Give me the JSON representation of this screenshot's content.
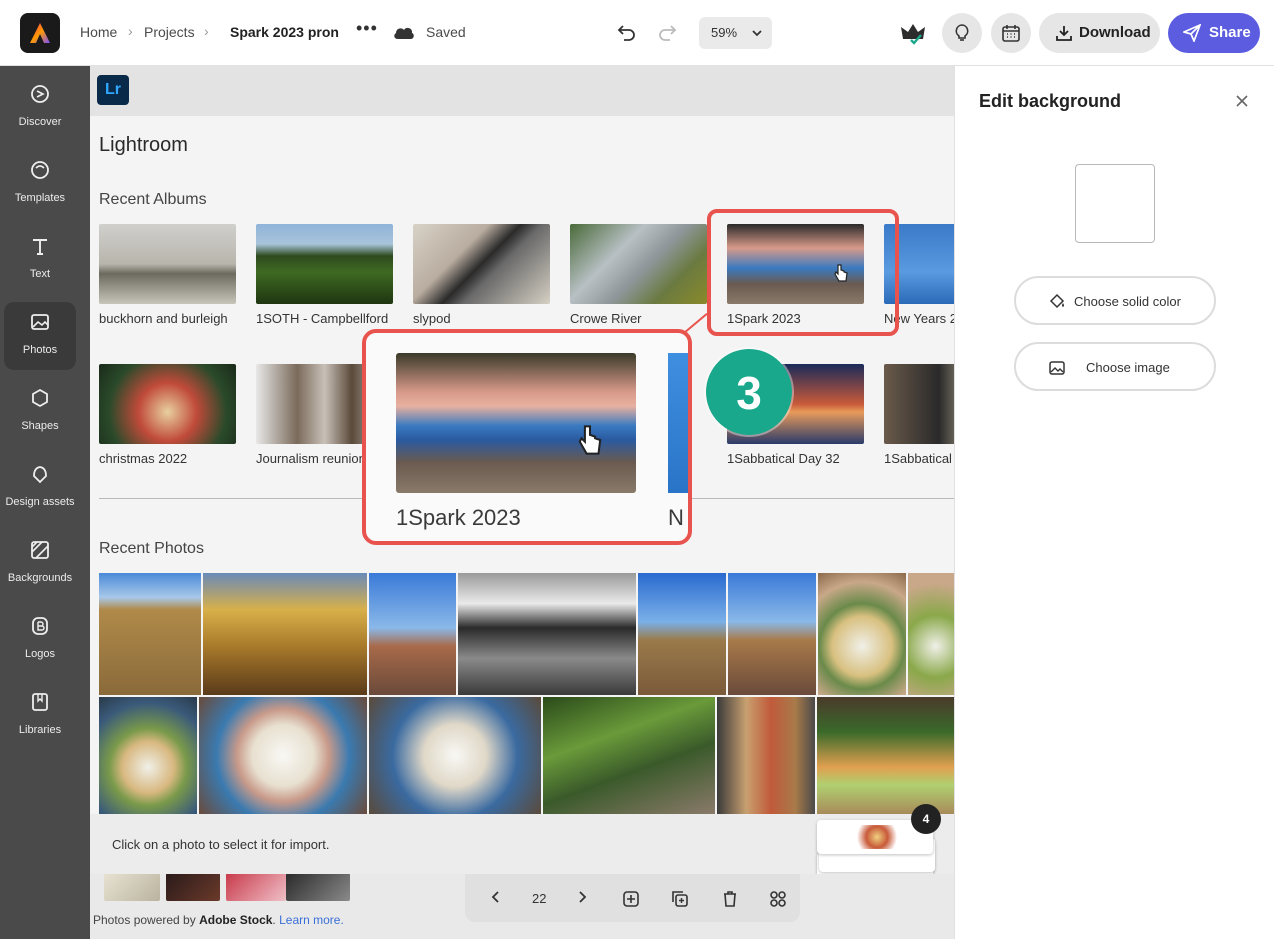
{
  "header": {
    "breadcrumbs": [
      "Home",
      "Projects"
    ],
    "doc_title": "Spark 2023 pron",
    "save_status": "Saved",
    "zoom": "59%",
    "download_label": "Download",
    "share_label": "Share",
    "accent": "#5c5ce0"
  },
  "rail": {
    "items": [
      {
        "label": "Discover",
        "icon": "discover-icon"
      },
      {
        "label": "Templates",
        "icon": "templates-icon"
      },
      {
        "label": "Text",
        "icon": "text-icon"
      },
      {
        "label": "Photos",
        "icon": "photos-icon",
        "active": true
      },
      {
        "label": "Shapes",
        "icon": "shapes-icon"
      },
      {
        "label": "Design assets",
        "icon": "design-assets-icon"
      },
      {
        "label": "Backgrounds",
        "icon": "backgrounds-icon"
      },
      {
        "label": "Logos",
        "icon": "logos-icon"
      },
      {
        "label": "Libraries",
        "icon": "libraries-icon"
      }
    ]
  },
  "modal": {
    "badge": "Lr",
    "title": "Lightroom",
    "recent_albums_title": "Recent Albums",
    "albums_row1": [
      "buckhorn and burleigh",
      "1SOTH - Campbellford",
      "slypod",
      "Crowe River",
      "1Spark 2023",
      "New Years 2"
    ],
    "albums_row2": [
      "christmas 2022",
      "Journalism reunion",
      "",
      "",
      "1Sabbatical Day 32",
      "1Sabbatical"
    ],
    "recent_photos_title": "Recent Photos",
    "footer_text": "Click on a photo to select it for import.",
    "selected_count": "4"
  },
  "callout": {
    "label": "1Spark 2023",
    "peek_label": "N",
    "step": "3"
  },
  "pager": {
    "page": "22"
  },
  "footer": {
    "powered_prefix": "Photos powered by ",
    "powered_brand": "Adobe Stock",
    "powered_suffix": ".",
    "learn_more": "Learn more."
  },
  "panel": {
    "title": "Edit background",
    "solid_color_label": "Choose solid color",
    "image_label": "Choose image"
  }
}
